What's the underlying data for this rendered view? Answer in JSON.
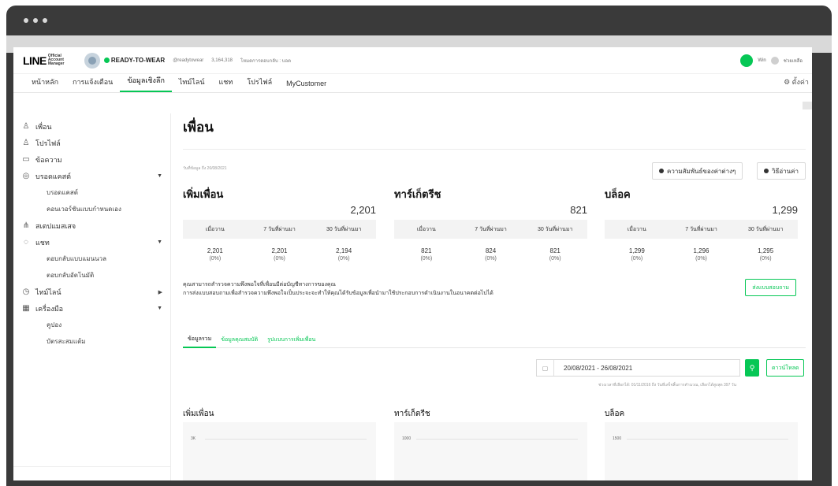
{
  "header": {
    "logo": "LINE",
    "logo_sub": "Official Account Manager",
    "account_name": "READY-TO-WEAR",
    "account_id": "@readytowear",
    "friends_count": "3,164,318",
    "plan": "โหมดการตอบกลับ : บอต",
    "user": "Win",
    "help": "ช่วยเหลือ"
  },
  "nav": {
    "items": [
      "หน้าหลัก",
      "การแจ้งเตือน",
      "ข้อมูลเชิงลึก",
      "ไทม์ไลน์",
      "แชท",
      "โปรไฟล์",
      "MyCustomer"
    ],
    "settings": "ตั้งค่า"
  },
  "sidebar": {
    "items": [
      {
        "label": "เพื่อน"
      },
      {
        "label": "โปรไฟล์"
      },
      {
        "label": "ข้อความ"
      },
      {
        "label": "บรอดแคสต์"
      },
      {
        "label": "บรอดแคสต์"
      },
      {
        "label": "คอนเวอร์ชันแบบกำหนดเอง"
      },
      {
        "label": "สเตปแมสเสจ"
      },
      {
        "label": "แชท"
      },
      {
        "label": "ตอบกลับแบบแมนนวล"
      },
      {
        "label": "ตอบกลับอัตโนมัติ"
      },
      {
        "label": "ไทม์ไลน์"
      },
      {
        "label": "เครื่องมือ"
      },
      {
        "label": "คูปอง"
      },
      {
        "label": "บัตรสะสมแต้ม"
      }
    ]
  },
  "main": {
    "title": "เพื่อน",
    "date_line": "วันที่ข้อมูล ถึง 26/08/2021",
    "relation_btn": "ความสัมพันธ์ของค่าต่างๆ",
    "howto_btn": "วิธีอ่านค่า",
    "stats": [
      {
        "title": "เพิ่มเพื่อน",
        "total": "2,201",
        "cols": [
          "เมื่อวาน",
          "7 วันที่ผ่านมา",
          "30 วันที่ผ่านมา"
        ],
        "vals": [
          "2,201",
          "2,201",
          "2,194"
        ],
        "pcts": [
          "(0%)",
          "(0%)",
          "(0%)"
        ]
      },
      {
        "title": "ทาร์เก็ตรีช",
        "total": "821",
        "cols": [
          "เมื่อวาน",
          "7 วันที่ผ่านมา",
          "30 วันที่ผ่านมา"
        ],
        "vals": [
          "821",
          "824",
          "821"
        ],
        "pcts": [
          "(0%)",
          "(0%)",
          "(0%)"
        ]
      },
      {
        "title": "บล็อค",
        "total": "1,299",
        "cols": [
          "เมื่อวาน",
          "7 วันที่ผ่านมา",
          "30 วันที่ผ่านมา"
        ],
        "vals": [
          "1,299",
          "1,296",
          "1,295"
        ],
        "pcts": [
          "(0%)",
          "(0%)",
          "(0%)"
        ]
      }
    ],
    "info_line1": "คุณสามารถสำรวจความพึงพอใจที่เพื่อนมีต่อบัญชีทางการของคุณ",
    "info_line2": "การส่งแบบสอบถามเพื่อสำรวจความพึงพอใจเป็นประจะจะทำให้คุณได้รับข้อมูลเพื่อนำมาใช้ประกอบการดำเนินงานในอนาคตต่อไปได้",
    "survey_btn": "ส่งแบบสอบถาม",
    "subtabs": [
      "ข้อมูลรวม",
      "ข้อมูลคุณสมบัติ",
      "รูปแบบการเพิ่มเพื่อน"
    ],
    "date_range": "20/08/2021 - 26/08/2021",
    "download_btn": "ดาวน์โหลด",
    "note": "ช่วงเวลาที่เลือกได้: 01/11/2016 ถึง วันที่เสร็จสิ้นการคำนวณ, เลือกได้สูงสุด 397 วัน",
    "charts": [
      {
        "title": "เพิ่มเพื่อน",
        "ytick": "3K"
      },
      {
        "title": "ทาร์เก็ตรีช",
        "ytick": "1000"
      },
      {
        "title": "บล็อค",
        "ytick": "1500"
      }
    ]
  }
}
